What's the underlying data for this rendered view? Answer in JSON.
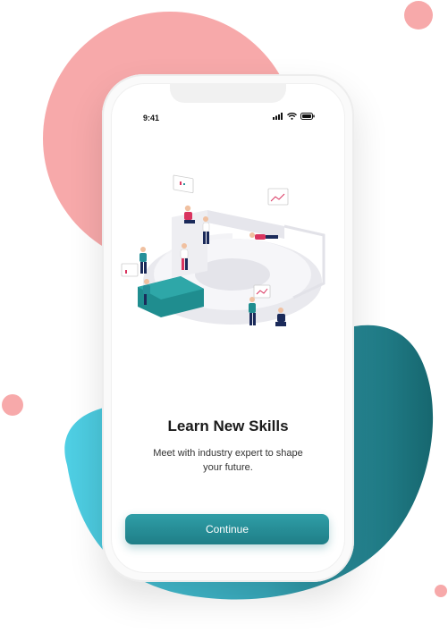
{
  "status_bar": {
    "time": "9:41",
    "icons": [
      "signal-icon",
      "wifi-icon",
      "battery-icon"
    ]
  },
  "onboarding": {
    "title": "Learn New Skills",
    "subtitle": "Meet with industry expert to shape your future.",
    "continue_label": "Continue"
  },
  "colors": {
    "accent": "#26909a",
    "coral_blob": "#f7a9aa",
    "cyan_blob": "#4fcfe4",
    "teal_dark": "#16676f"
  }
}
